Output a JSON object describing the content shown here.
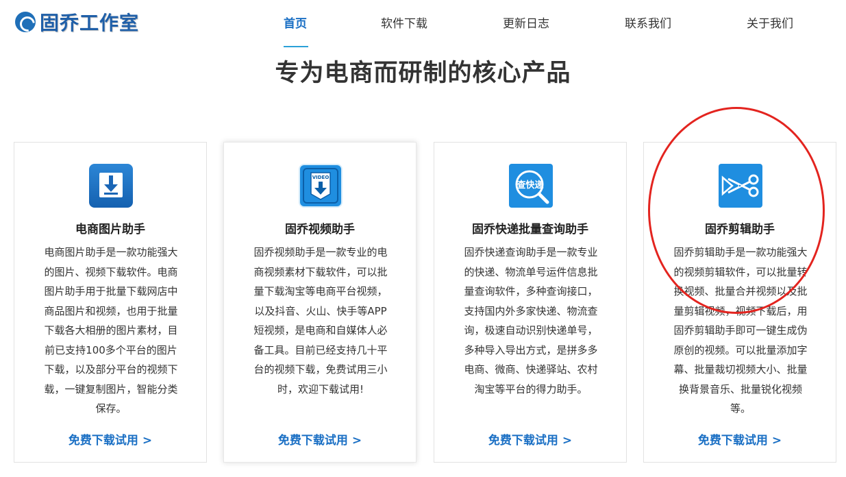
{
  "brand": {
    "name": "固乔工作室"
  },
  "nav": {
    "items": [
      {
        "label": "首页",
        "active": true
      },
      {
        "label": "软件下载",
        "active": false
      },
      {
        "label": "更新日志",
        "active": false
      },
      {
        "label": "联系我们",
        "active": false
      },
      {
        "label": "关于我们",
        "active": false
      }
    ]
  },
  "section": {
    "title": "专为电商而研制的核心产品"
  },
  "products": [
    {
      "icon": "download-icon",
      "title": "电商图片助手",
      "description": "电商图片助手是一款功能强大的图片、视频下载软件。电商图片助手用于批量下载网店中商品图片和视频，也用于批量下载各大相册的图片素材，目前已支持100多个平台的图片下载，以及部分平台的视频下载，一键复制图片，智能分类保存。",
      "link": "免费下载试用 >"
    },
    {
      "icon": "video-download-icon",
      "icon_text": "VIDEO",
      "title": "固乔视频助手",
      "description": "固乔视频助手是一款专业的电商视频素材下载软件，可以批量下载淘宝等电商平台视频，以及抖音、火山、快手等APP短视频，是电商和自媒体人必备工具。目前已经支持几十平台的视频下载，免费试用三小时，欢迎下载试用!",
      "link": "免费下载试用 >"
    },
    {
      "icon": "express-search-icon",
      "icon_text": "查快递",
      "title": "固乔快递批量查询助手",
      "description": "固乔快递查询助手是一款专业的快递、物流单号运件信息批量查询软件，多种查询接口，支持国内外多家快递、物流查询，极速自动识别快递单号，多种导入导出方式，是拼多多电商、微商、快递驿站、农村淘宝等平台的得力助手。",
      "link": "免费下载试用 >"
    },
    {
      "icon": "video-edit-scissors-icon",
      "title": "固乔剪辑助手",
      "description": "固乔剪辑助手是一款功能强大的视频剪辑软件，可以批量转换视频、批量合并视频以及批量剪辑视频，视频下载后，用固乔剪辑助手即可一键生成伪原创的视频。可以批量添加字幕、批量裁切视频大小、批量换背景音乐、批量锐化视频等。",
      "link": "免费下载试用 >"
    }
  ],
  "colors": {
    "accent": "#1a6fc4",
    "nav_underline": "#2aa0d8",
    "annotation": "#e3241f"
  }
}
